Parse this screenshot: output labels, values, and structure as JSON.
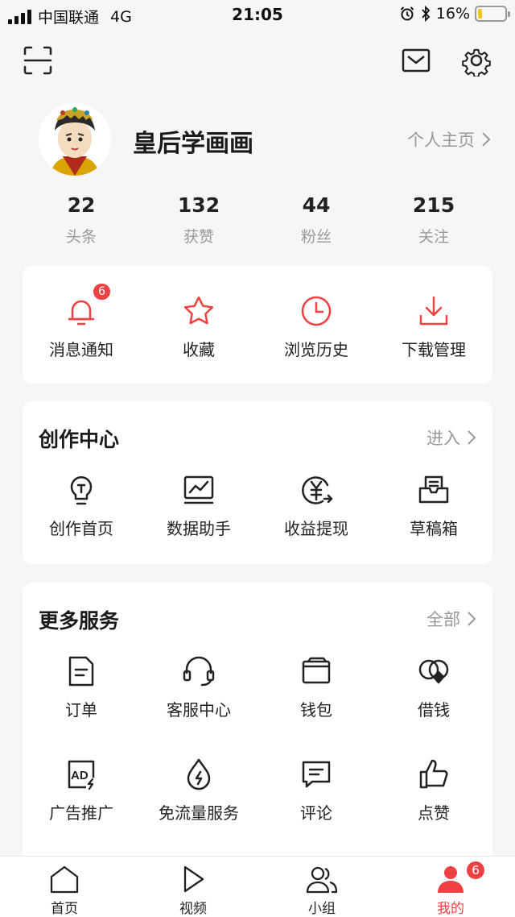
{
  "status_bar": {
    "carrier": "中国联通",
    "network": "4G",
    "time": "21:05",
    "battery_percent": "16%",
    "battery_level": 0.16
  },
  "profile": {
    "username": "皇后学画画",
    "homepage_link": "个人主页"
  },
  "stats": [
    {
      "value": "22",
      "label": "头条"
    },
    {
      "value": "132",
      "label": "获赞"
    },
    {
      "value": "44",
      "label": "粉丝"
    },
    {
      "value": "215",
      "label": "关注"
    }
  ],
  "quick_actions": [
    {
      "label": "消息通知",
      "icon": "bell-icon",
      "badge": "6"
    },
    {
      "label": "收藏",
      "icon": "star-icon"
    },
    {
      "label": "浏览历史",
      "icon": "clock-icon"
    },
    {
      "label": "下载管理",
      "icon": "download-icon"
    }
  ],
  "creator_center": {
    "title": "创作中心",
    "more": "进入",
    "items": [
      {
        "label": "创作首页",
        "icon": "lightbulb-icon"
      },
      {
        "label": "数据助手",
        "icon": "chart-monitor-icon"
      },
      {
        "label": "收益提现",
        "icon": "yen-coin-icon"
      },
      {
        "label": "草稿箱",
        "icon": "draft-box-icon"
      }
    ]
  },
  "more_services": {
    "title": "更多服务",
    "more": "全部",
    "items": [
      {
        "label": "订单",
        "icon": "document-icon"
      },
      {
        "label": "客服中心",
        "icon": "headset-icon"
      },
      {
        "label": "钱包",
        "icon": "wallet-icon"
      },
      {
        "label": "借钱",
        "icon": "loan-icon"
      },
      {
        "label": "广告推广",
        "icon": "ad-icon"
      },
      {
        "label": "免流量服务",
        "icon": "droplet-icon"
      },
      {
        "label": "评论",
        "icon": "comment-icon"
      },
      {
        "label": "点赞",
        "icon": "thumbs-up-icon"
      }
    ]
  },
  "tabbar": {
    "items": [
      {
        "label": "首页",
        "icon": "home-icon"
      },
      {
        "label": "视频",
        "icon": "play-icon"
      },
      {
        "label": "小组",
        "icon": "group-icon"
      },
      {
        "label": "我的",
        "icon": "profile-icon",
        "badge": "6",
        "active": true
      }
    ]
  },
  "colors": {
    "accent": "#f04142",
    "background": "#f6f6f6",
    "card": "#ffffff",
    "battery": "#f5c518"
  }
}
